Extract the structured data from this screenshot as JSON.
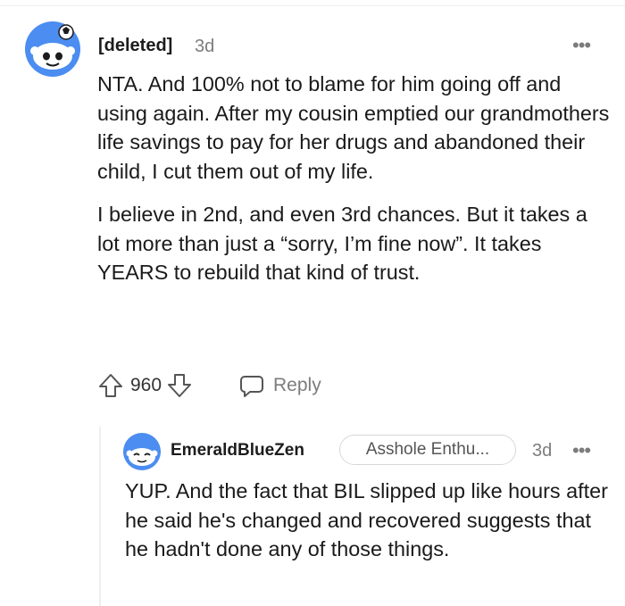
{
  "comment": {
    "author": "[deleted]",
    "age": "3d",
    "more_label": "•••",
    "paragraphs": [
      "NTA. And 100% not to blame for him going off and using again. After my cousin emptied our grandmothers life savings to pay for her drugs and abandoned their child, I cut them out of my life.",
      "I believe in 2nd, and even 3rd chances. But it takes a lot more than just a “sorry, I’m fine now”. It takes YEARS to rebuild that kind of trust."
    ],
    "score": "960",
    "reply_label": "Reply",
    "icons": {
      "upvote": "upvote-arrow-icon",
      "downvote": "downvote-arrow-icon",
      "reply": "speech-bubble-icon"
    }
  },
  "reply": {
    "author": "EmeraldBlueZen",
    "flair": "Asshole Enthu...",
    "age": "3d",
    "more_label": "•••",
    "text": "YUP. And the fact that BIL slipped up like hours after he said he's changed and recovered suggests that he hadn't done any of those things."
  },
  "colors": {
    "avatar_blue": "#3b8cf5",
    "text": "#1a1a1b",
    "meta": "#7c7c7c"
  }
}
